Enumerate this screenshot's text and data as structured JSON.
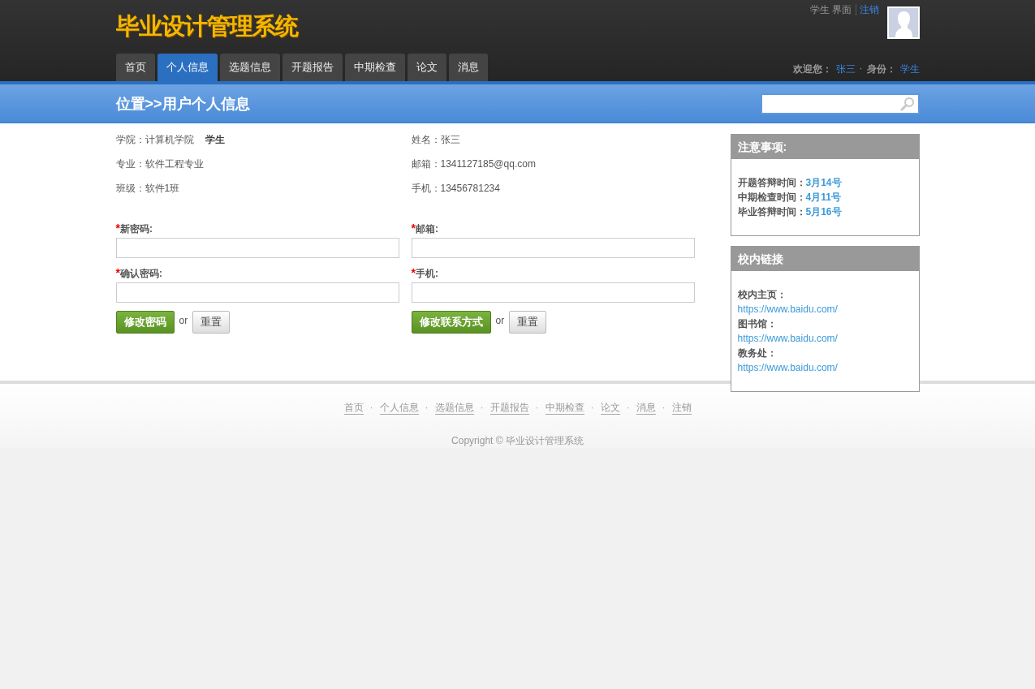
{
  "header": {
    "title": "毕业设计管理系统",
    "user_links": {
      "role_view": "学生 界面",
      "logout": "注销"
    },
    "welcome": {
      "label": "欢迎您：",
      "name": "张三",
      "separator": "·",
      "role_label": "身份：",
      "role": "学生"
    }
  },
  "nav": [
    {
      "label": "首页",
      "selected": false
    },
    {
      "label": "个人信息",
      "selected": true
    },
    {
      "label": "选题信息",
      "selected": false
    },
    {
      "label": "开题报告",
      "selected": false
    },
    {
      "label": "中期检查",
      "selected": false
    },
    {
      "label": "论文",
      "selected": false
    },
    {
      "label": "消息",
      "selected": false
    }
  ],
  "breadcrumb": "位置>>用户个人信息",
  "info": {
    "left": [
      {
        "label": "学院：",
        "value": "计算机学院",
        "extra": "学生"
      },
      {
        "label": "专业：",
        "value": "软件工程专业"
      },
      {
        "label": "班级：",
        "value": "软件1班"
      }
    ],
    "right": [
      {
        "label": "姓名：",
        "value": "张三"
      },
      {
        "label": "邮箱：",
        "value": "1341127185@qq.com"
      },
      {
        "label": "手机：",
        "value": "13456781234"
      }
    ]
  },
  "forms": [
    {
      "fields": [
        {
          "required_mark": "*",
          "label": "新密码:"
        },
        {
          "required_mark": "*",
          "label": "确认密码:"
        }
      ],
      "submit": "修改密码",
      "or": "or",
      "reset": "重置"
    },
    {
      "fields": [
        {
          "required_mark": "*",
          "label": "邮箱:"
        },
        {
          "required_mark": "*",
          "label": "手机:"
        }
      ],
      "submit": "修改联系方式",
      "or": "or",
      "reset": "重置"
    }
  ],
  "sidebar": [
    {
      "title": "注意事项:",
      "kind": "dates",
      "items": [
        {
          "label": "开题答辩时间：",
          "value": "3月14号"
        },
        {
          "label": "中期检查时间：",
          "value": "4月11号"
        },
        {
          "label": "毕业答辩时间：",
          "value": "5月16号"
        }
      ]
    },
    {
      "title": "校内链接",
      "kind": "links",
      "items": [
        {
          "label": "校内主页：",
          "value": "https://www.baidu.com/"
        },
        {
          "label": "图书馆：",
          "value": "https://www.baidu.com/"
        },
        {
          "label": "教务处：",
          "value": "https://www.baidu.com/"
        }
      ]
    }
  ],
  "footer": {
    "links": [
      "首页",
      "个人信息",
      "选题信息",
      "开题报告",
      "中期检查",
      "论文",
      "消息",
      "注销"
    ],
    "separator": "·",
    "copyright": "Copyright © 毕业设计管理系统"
  }
}
